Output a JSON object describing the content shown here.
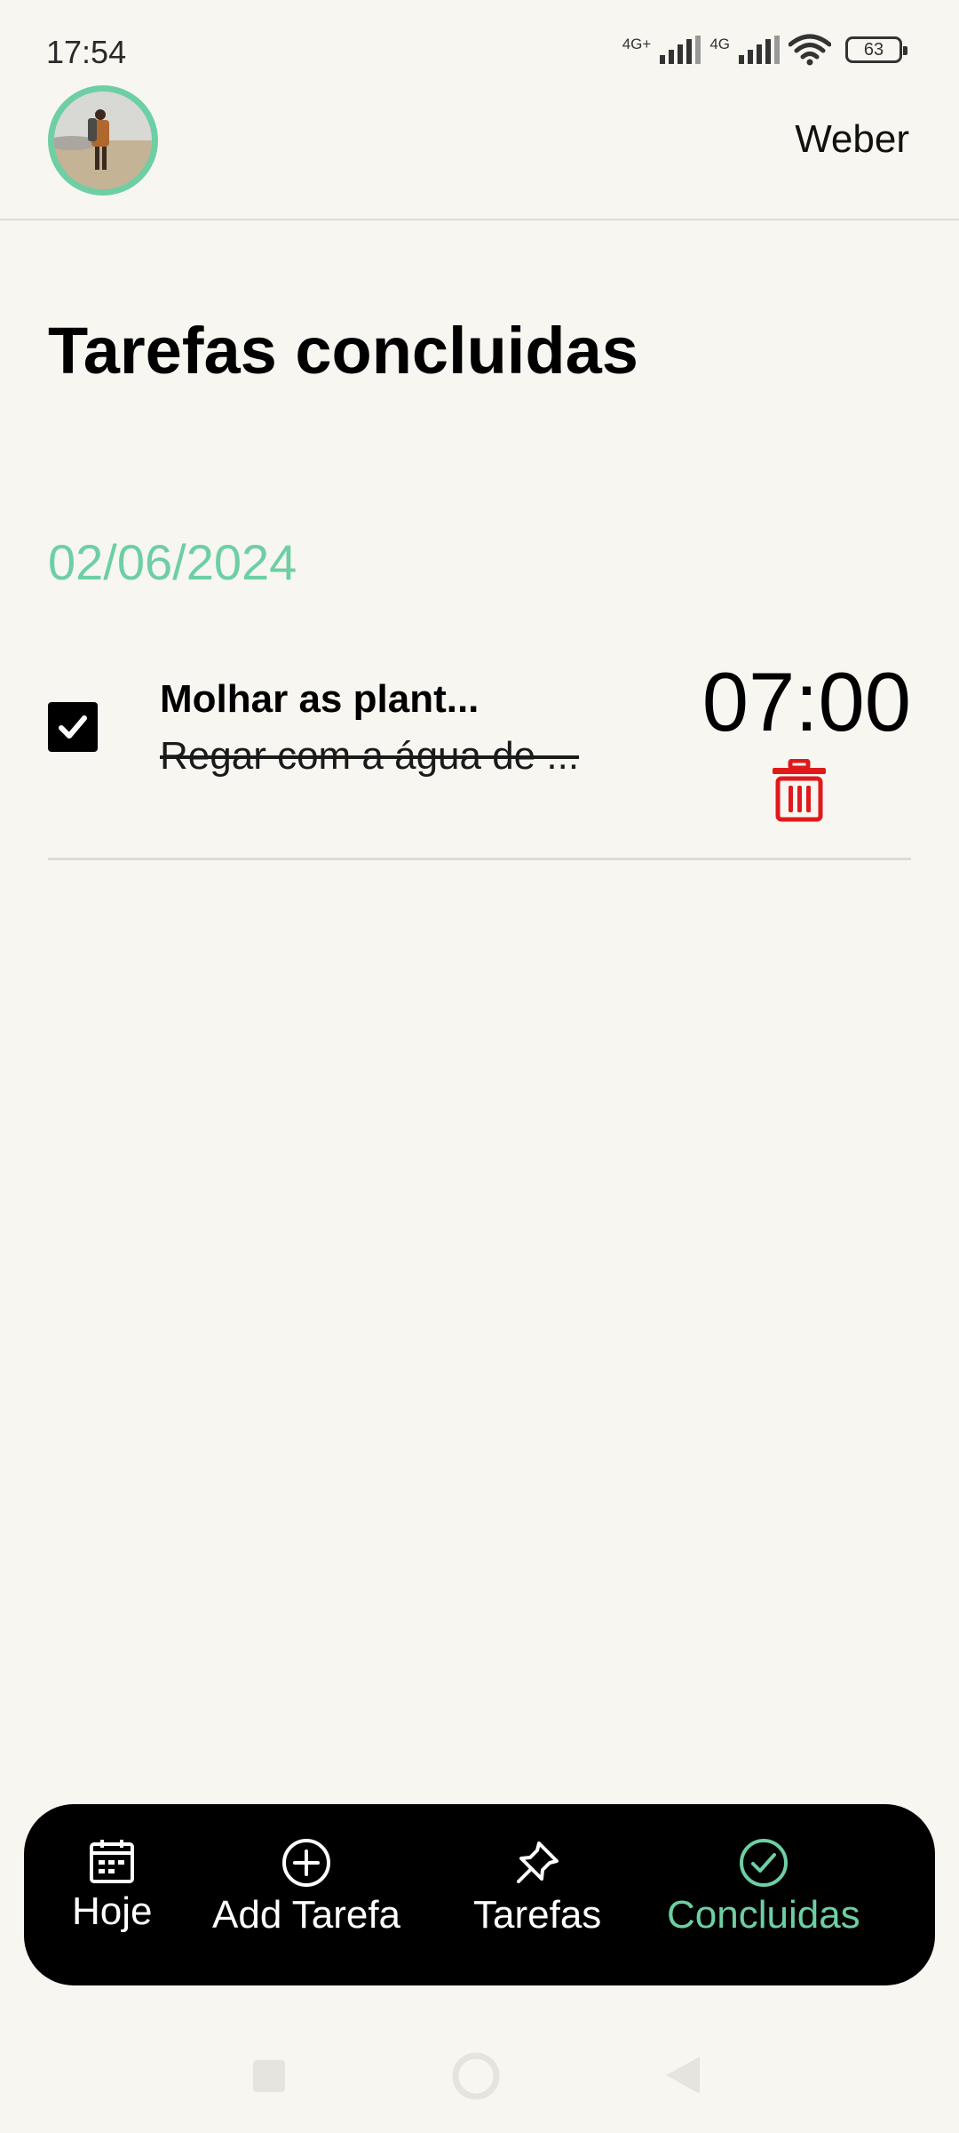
{
  "status_bar": {
    "time": "17:54",
    "network_1": "4G+",
    "network_2": "4G",
    "battery": "63"
  },
  "header": {
    "user_name": "Weber"
  },
  "page": {
    "title": "Tarefas concluidas"
  },
  "task_groups": [
    {
      "date": "02/06/2024",
      "tasks": [
        {
          "title": "Molhar as plant...",
          "description": "Regar com a água de ...",
          "time": "07:00",
          "completed": true
        }
      ]
    }
  ],
  "bottom_nav": {
    "items": [
      {
        "label": "Hoje",
        "icon": "calendar-icon"
      },
      {
        "label": "Add Tarefa",
        "icon": "plus-circle-icon"
      },
      {
        "label": "Tarefas",
        "icon": "pin-icon"
      },
      {
        "label": "Concluidas",
        "icon": "check-circle-icon",
        "active": true
      }
    ]
  },
  "colors": {
    "accent": "#6dcfa3",
    "background": "#f8f6f0",
    "delete": "#e0191b",
    "nav_bg": "#000000"
  }
}
